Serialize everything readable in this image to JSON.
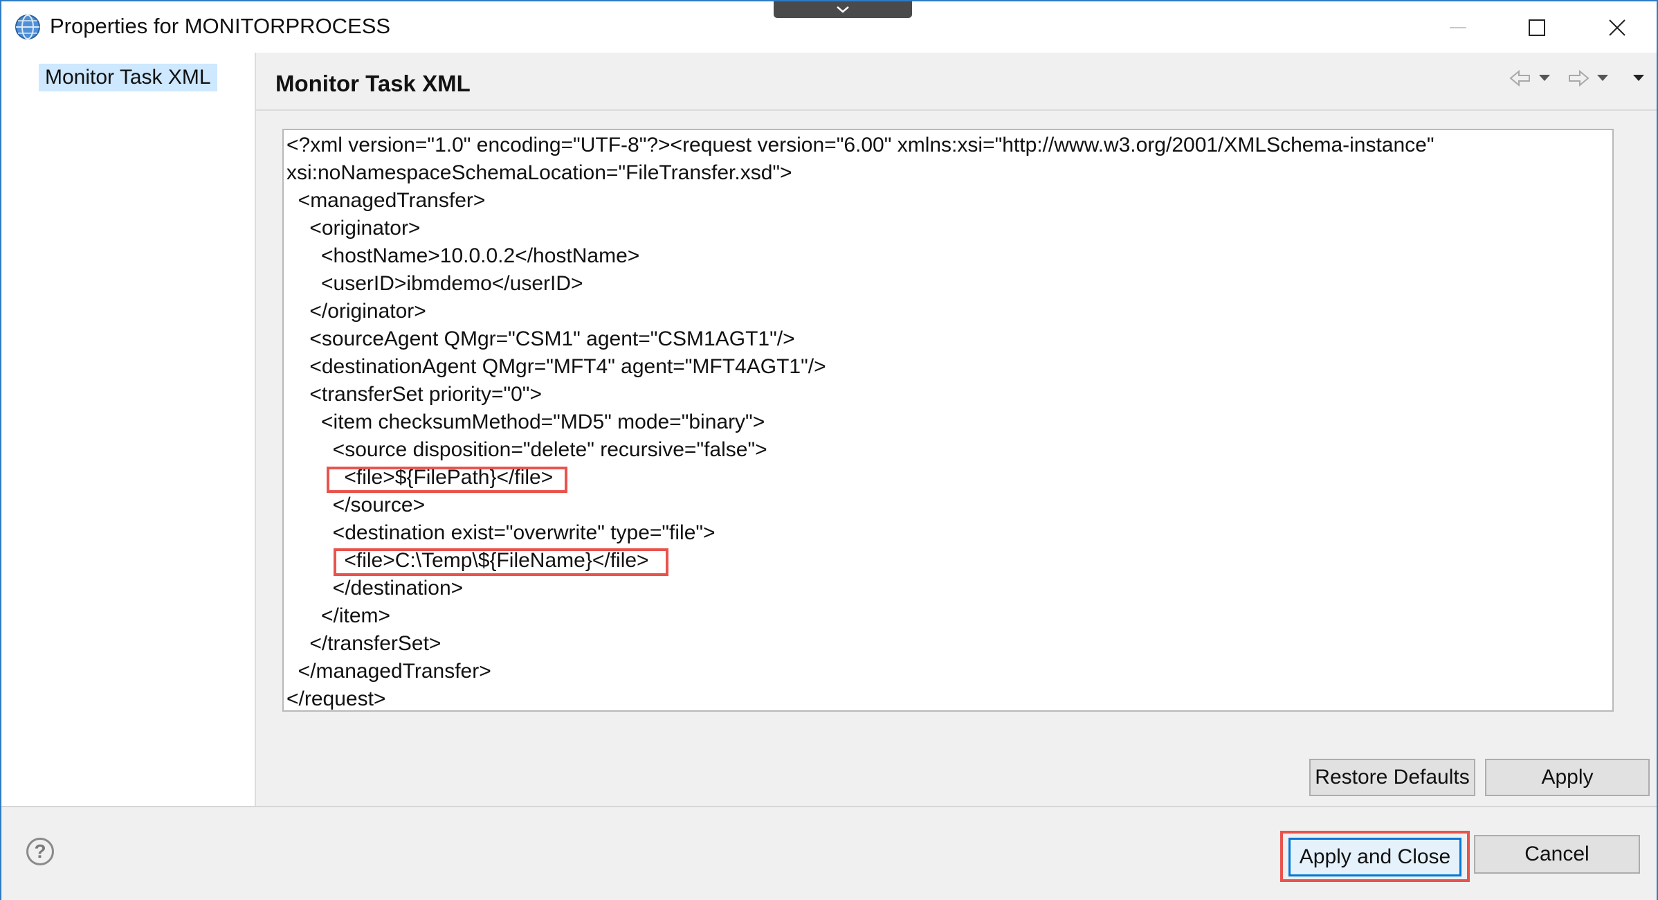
{
  "window": {
    "title": "Properties for MONITORPROCESS",
    "icons": {
      "app": "globe-gear-icon",
      "collapse_handle": "chevron-down-icon",
      "minimize": "minimize-icon",
      "maximize": "maximize-icon",
      "close": "close-icon"
    }
  },
  "sidebar": {
    "items": [
      {
        "label": "Monitor Task XML",
        "selected": true
      }
    ]
  },
  "page": {
    "title": "Monitor Task XML",
    "nav_icons": [
      "back-arrow-icon",
      "back-dropdown-icon",
      "forward-arrow-icon",
      "forward-dropdown-icon",
      "view-menu-icon"
    ]
  },
  "xml": {
    "lines": [
      "<?xml version=\"1.0\" encoding=\"UTF-8\"?><request version=\"6.00\" xmlns:xsi=\"http://www.w3.org/2001/XMLSchema-instance\"",
      "xsi:noNamespaceSchemaLocation=\"FileTransfer.xsd\">",
      "  <managedTransfer>",
      "    <originator>",
      "      <hostName>10.0.0.2</hostName>",
      "      <userID>ibmdemo</userID>",
      "    </originator>",
      "    <sourceAgent QMgr=\"CSM1\" agent=\"CSM1AGT1\"/>",
      "    <destinationAgent QMgr=\"MFT4\" agent=\"MFT4AGT1\"/>",
      "    <transferSet priority=\"0\">",
      "      <item checksumMethod=\"MD5\" mode=\"binary\">",
      "        <source disposition=\"delete\" recursive=\"false\">",
      "          <file>${FilePath}</file>",
      "        </source>",
      "        <destination exist=\"overwrite\" type=\"file\">",
      "          <file>C:\\Temp\\${FileName}</file>",
      "        </destination>",
      "      </item>",
      "    </transferSet>",
      "  </managedTransfer>",
      "</request>"
    ],
    "highlighted_lines": [
      12,
      15
    ],
    "highlight_color": "#e8534c"
  },
  "buttons": {
    "restore_defaults": "Restore Defaults",
    "apply": "Apply",
    "apply_and_close": "Apply and Close",
    "cancel": "Cancel",
    "help_icon": "help-icon"
  },
  "colors": {
    "selection": "#cde8ff",
    "focus_border": "#0078d7",
    "annotation": "#e8534c"
  }
}
